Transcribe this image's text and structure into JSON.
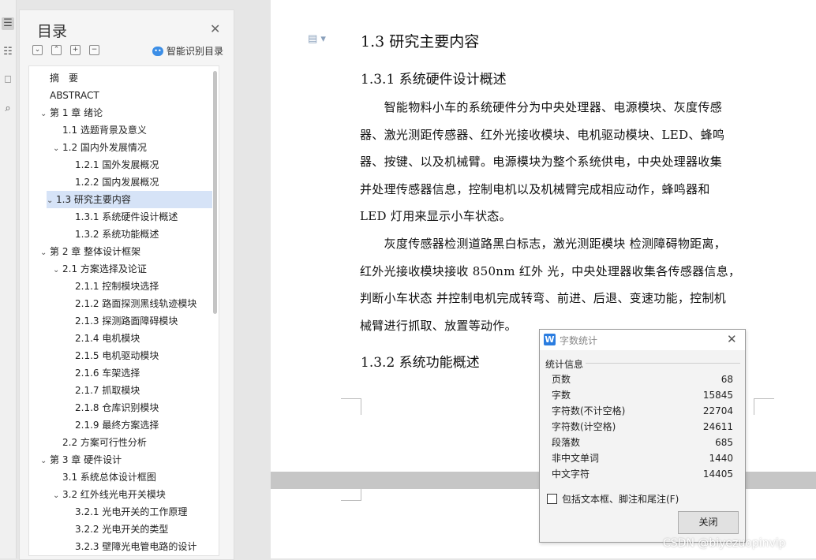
{
  "sidebar_rail": {
    "icons": [
      "outline-icon",
      "list-icon",
      "bookmark-icon",
      "find-icon"
    ]
  },
  "toc_panel": {
    "title": "目录",
    "smart_toc_label": "智能识别目录",
    "items": [
      {
        "label": "摘　要",
        "level": 0,
        "expander": false,
        "selected": false
      },
      {
        "label": "ABSTRACT",
        "level": 0,
        "expander": false,
        "selected": false
      },
      {
        "label": "第 1 章  绪论",
        "level": 0,
        "expander": true,
        "selected": false
      },
      {
        "label": "1.1 选题背景及意义",
        "level": 1,
        "expander": false,
        "selected": false
      },
      {
        "label": "1.2  国内外发展情况",
        "level": 1,
        "expander": true,
        "selected": false
      },
      {
        "label": "1.2.1 国外发展概况",
        "level": 2,
        "expander": false,
        "selected": false
      },
      {
        "label": "1.2.2 国内发展概况",
        "level": 2,
        "expander": false,
        "selected": false
      },
      {
        "label": "1.3 研究主要内容",
        "level": 1,
        "expander": true,
        "selected": true
      },
      {
        "label": "1.3.1  系统硬件设计概述",
        "level": 2,
        "expander": false,
        "selected": false
      },
      {
        "label": "1.3.2  系统功能概述",
        "level": 2,
        "expander": false,
        "selected": false
      },
      {
        "label": "第 2 章  整体设计框架",
        "level": 0,
        "expander": true,
        "selected": false
      },
      {
        "label": "2.1  方案选择及论证",
        "level": 1,
        "expander": true,
        "selected": false
      },
      {
        "label": "2.1.1  控制模块选择",
        "level": 2,
        "expander": false,
        "selected": false
      },
      {
        "label": "2.1.2  路面探测黑线轨迹模块",
        "level": 2,
        "expander": false,
        "selected": false
      },
      {
        "label": "2.1.3  探测路面障碍模块",
        "level": 2,
        "expander": false,
        "selected": false
      },
      {
        "label": "2.1.4  电机模块",
        "level": 2,
        "expander": false,
        "selected": false
      },
      {
        "label": "2.1.5  电机驱动模块",
        "level": 2,
        "expander": false,
        "selected": false
      },
      {
        "label": "2.1.6  车架选择",
        "level": 2,
        "expander": false,
        "selected": false
      },
      {
        "label": "2.1.7  抓取模块",
        "level": 2,
        "expander": false,
        "selected": false
      },
      {
        "label": "2.1.8  仓库识别模块",
        "level": 2,
        "expander": false,
        "selected": false
      },
      {
        "label": "2.1.9  最终方案选择",
        "level": 2,
        "expander": false,
        "selected": false
      },
      {
        "label": "2.2  方案可行性分析",
        "level": 1,
        "expander": false,
        "selected": false
      },
      {
        "label": "第 3 章  硬件设计",
        "level": 0,
        "expander": true,
        "selected": false
      },
      {
        "label": "3.1  系统总体设计框图",
        "level": 1,
        "expander": false,
        "selected": false
      },
      {
        "label": "3.2  红外线光电开关模块",
        "level": 1,
        "expander": true,
        "selected": false
      },
      {
        "label": "3.2.1  光电开关的工作原理",
        "level": 2,
        "expander": false,
        "selected": false
      },
      {
        "label": "3.2.2  光电开关的类型",
        "level": 2,
        "expander": false,
        "selected": false
      },
      {
        "label": "3.2.3  壁障光电管电路的设计",
        "level": 2,
        "expander": false,
        "selected": false
      }
    ]
  },
  "document": {
    "section_heading": "1.3 研究主要内容",
    "sub1_heading": "1.3.1  系统硬件设计概述",
    "para1": [
      "　　智能物料小车的系统硬件分为中央处理器、电源模块、灰度传感",
      "器、激光测距传感器、红外光接收模块、电机驱动模块、LED、蜂鸣",
      "器、按键、以及机械臂。电源模块为整个系统供电，中央处理器收集",
      "并处理传感器信息，控制电机以及机械臂完成相应动作，蜂鸣器和",
      "LED 灯用来显示小车状态。"
    ],
    "para2": [
      "　　灰度传感器检测道路黑白标志，激光测距模块  检测障碍物距离，",
      "红外光接收模块接收 850nm 红外  光，中央处理器收集各传感器信息，",
      "判断小车状态  并控制电机完成转弯、前进、后退、变速功能，控制机",
      "械臂进行抓取、放置等动作。"
    ],
    "sub2_heading": "1.3.2  系统功能概述"
  },
  "word_count_dialog": {
    "title": "字数统计",
    "section_label": "统计信息",
    "stats": [
      {
        "label": "页数",
        "value": "68"
      },
      {
        "label": "字数",
        "value": "15845"
      },
      {
        "label": "字符数(不计空格)",
        "value": "22704"
      },
      {
        "label": "字符数(计空格)",
        "value": "24611"
      },
      {
        "label": "段落数",
        "value": "685"
      },
      {
        "label": "非中文单词",
        "value": "1440"
      },
      {
        "label": "中文字符",
        "value": "14405"
      }
    ],
    "checkbox_label": "包括文本框、脚注和尾注(F)",
    "checkbox_checked": false,
    "close_button_label": "关闭"
  },
  "watermark": "CSDN @biyezuopinvip",
  "colors": {
    "selected_row": "#d6e3f7",
    "dialog_logo": "#2b7de0",
    "page_gap": "#c6c6c6"
  }
}
